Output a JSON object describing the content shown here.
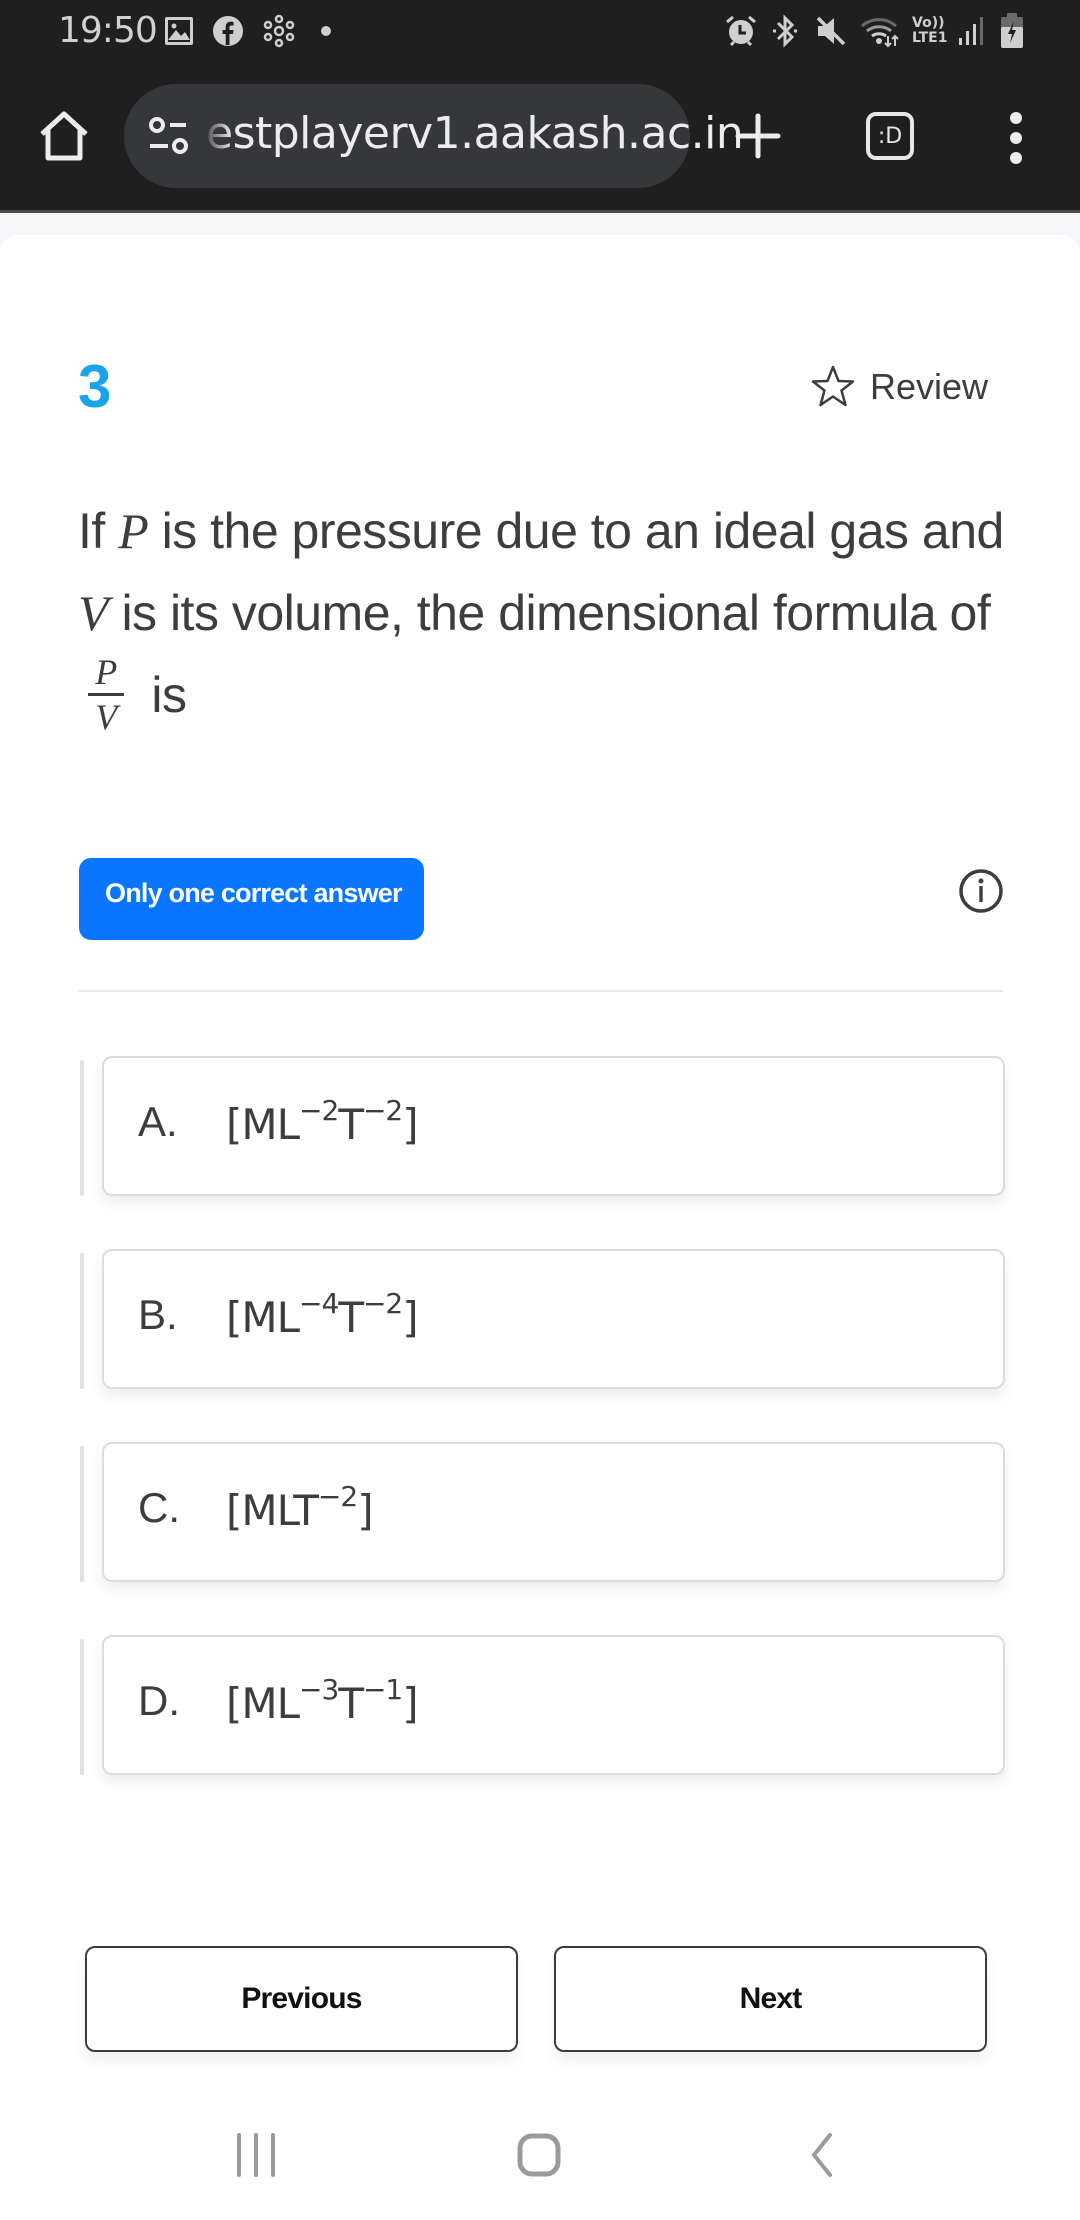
{
  "status_bar": {
    "time": "19:50",
    "left_icons": [
      "gallery-icon",
      "facebook-icon",
      "network-nodes-icon",
      "dot-icon"
    ],
    "right_icons": [
      "alarm-icon",
      "bluetooth-icon",
      "mute-icon",
      "wifi-icon",
      "volte-lte-icon",
      "signal-icon",
      "battery-charging-icon"
    ],
    "volte_label": "Vo))",
    "lte_label": "LTE1"
  },
  "browser": {
    "url": "estplayerv1.aakash.ac.in",
    "tab_switcher_label": ":D",
    "icons": [
      "home-icon",
      "site-settings-icon",
      "new-tab-icon",
      "tab-switcher-icon",
      "more-menu-icon"
    ]
  },
  "question": {
    "number": "3",
    "review_label": "Review",
    "text_parts": {
      "p1": "If ",
      "var_p": "P",
      "p2": " is the pressure due to an ideal gas and ",
      "var_v": "V",
      "p3": " is its volume, the dimensional formula of ",
      "frac_num": "P",
      "frac_den": "V",
      "p4": " is"
    },
    "type_badge": "Only one correct answer"
  },
  "options": [
    {
      "letter": "A.",
      "base1": "[ML",
      "exp1": "−2",
      "base2": "T",
      "exp2": "−2",
      "end": "]"
    },
    {
      "letter": "B.",
      "base1": "[ML",
      "exp1": "−4",
      "base2": "T",
      "exp2": "−2",
      "end": "]"
    },
    {
      "letter": "C.",
      "base1": "[MLT",
      "exp1": "−2",
      "base2": "",
      "exp2": "",
      "end": "]"
    },
    {
      "letter": "D.",
      "base1": "[ML",
      "exp1": "−3",
      "base2": "T",
      "exp2": "−1",
      "end": "]"
    }
  ],
  "navigation": {
    "previous_label": "Previous",
    "next_label": "Next"
  },
  "colors": {
    "accent_number": "#1aa3e8",
    "badge_bg": "#0a76ff",
    "toolbar_bg": "#1f1f1f"
  }
}
